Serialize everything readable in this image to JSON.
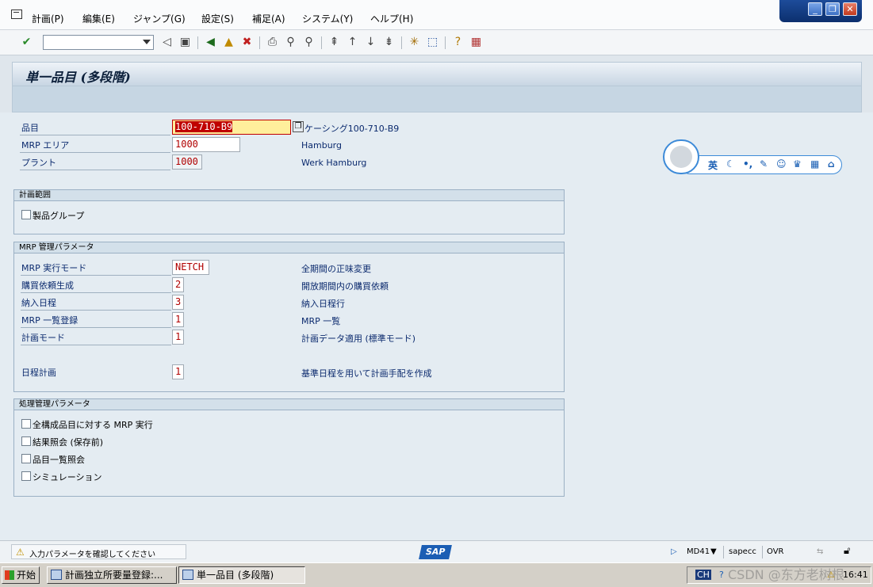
{
  "menu": {
    "items": [
      "計画(P)",
      "編集(E)",
      "ジャンプ(G)",
      "設定(S)",
      "補足(A)",
      "システム(Y)",
      "ヘルプ(H)"
    ]
  },
  "window_controls": {
    "minimize": "_",
    "restore": "❐",
    "close": "✕"
  },
  "toolbar": {
    "icons": [
      "enter-icon",
      "back-icon",
      "save-icon",
      "green-back-icon",
      "exit-icon",
      "cancel-icon",
      "print-icon",
      "find-icon",
      "find-next-icon",
      "first-page-icon",
      "prev-page-icon",
      "next-page-icon",
      "last-page-icon",
      "new-session-icon",
      "shortcut-icon",
      "help-icon",
      "layout-icon"
    ]
  },
  "title": "単一品目 (多段階)",
  "header_fields": {
    "material": {
      "label": "品目",
      "value": "100-710-B9",
      "desc": "ケーシング100-710-B9"
    },
    "mrp_area": {
      "label": "MRP エリア",
      "value": "1000",
      "desc": "Hamburg"
    },
    "plant": {
      "label": "プラント",
      "value": "1000",
      "desc": "Werk Hamburg"
    }
  },
  "planning_scope": {
    "title": "計画範囲",
    "product_group": "製品グループ"
  },
  "mrp_params": {
    "title": "MRP 管理パラメータ",
    "rows": [
      {
        "label": "MRP 実行モード",
        "value": "NETCH",
        "desc": "全期間の正味変更"
      },
      {
        "label": "購買依頼生成",
        "value": "2",
        "desc": "開放期間内の購買依頼"
      },
      {
        "label": "納入日程",
        "value": "3",
        "desc": "納入日程行"
      },
      {
        "label": "MRP 一覧登録",
        "value": "1",
        "desc": "MRP 一覧"
      },
      {
        "label": "計画モード",
        "value": "1",
        "desc": "計画データ適用 (標準モード)"
      },
      {
        "label": "日程計画",
        "value": "1",
        "desc": "基準日程を用いて計画手配を作成"
      }
    ]
  },
  "process_params": {
    "title": "処理管理パラメータ",
    "checkboxes": [
      "全構成品目に対する MRP 実行",
      "結果照会 (保存前)",
      "品目一覧照会",
      "シミュレーション"
    ]
  },
  "ime": {
    "label": "英"
  },
  "status": {
    "message": "入力パラメータを確認してください",
    "logo": "SAP",
    "transaction": "MD41",
    "server": "sapecc",
    "mode": "OVR"
  },
  "taskbar": {
    "start": "开始",
    "tasks": [
      "計画独立所要量登録:...",
      "単一品目 (多段階)"
    ],
    "lang": "CH",
    "clock": "16:41"
  },
  "watermark": "CSDN @东方老树根",
  "colors": {
    "accent": "#0b2a6e",
    "field_text": "#b00000",
    "highlight": "#c00000",
    "focus_bg": "#ffef9c"
  }
}
